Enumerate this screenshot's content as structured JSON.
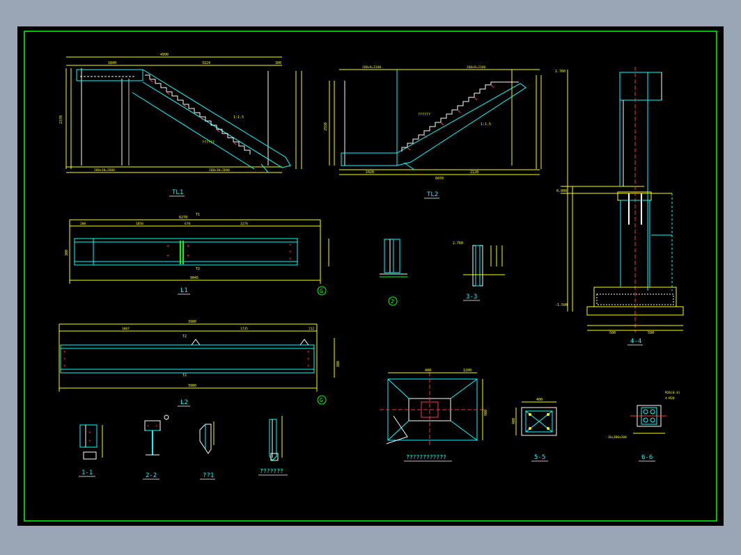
{
  "titles": {
    "tl1": "TL1",
    "tl2": "TL2",
    "l1": "L1",
    "l2": "L2",
    "s44": "4-4",
    "s33": "3-3",
    "s11": "1-1",
    "s22": "2-2",
    "s55": "5-5",
    "s66": "6-6",
    "q1": "??1",
    "q7": "???????",
    "q12": "????????????",
    "circ1": "2",
    "circ2": "G",
    "circ3": "G"
  },
  "dims": {
    "tl1_top": "4990",
    "tl1_a": "1840",
    "tl1_b": "3124",
    "tl1_c": "300",
    "tl1_h": "2370",
    "tl1_bot1": "260x10=2600",
    "tl1_bot2": "260x10=2600",
    "tl1_note": "??????",
    "tl1_slope": "1:1.5",
    "tl2_top1": "260x9=2340",
    "tl2_top2": "260x9=2340",
    "tl2_h": "2550",
    "tl2_bot": "6070",
    "tl2_b1": "2420",
    "tl2_b2": "2120",
    "tl2_note": "??????",
    "tl2_slope": "1:1.5",
    "l1_total": "6270",
    "l1_a": "200",
    "l1_b": "1850",
    "l1_c": "670",
    "l1_d": "3270",
    "l1_bot": "9045",
    "l1_h": "300",
    "l1_t1": "T1",
    "l1_t2": "T2",
    "l2_total": "3980",
    "l2_a": "1867",
    "l2_b": "1735",
    "l2_c": "722",
    "l2_bot": "3980",
    "l2_t1": "T2",
    "l2_t2": "T2",
    "l2_h": "300",
    "s44_top": "2.760",
    "s44_mid": "0.000",
    "s44_low": "-1.500",
    "s44_b1": "500",
    "s44_b2": "500",
    "s33_top": "2.760",
    "s55_w": "400",
    "s55_h": "400",
    "s66_note1": "M20(8.8)",
    "s66_note2": "4-M20",
    "s66_note3": "-16x300x300",
    "fnd_a": "400",
    "fnd_b": "1200",
    "fnd_c": "900"
  }
}
